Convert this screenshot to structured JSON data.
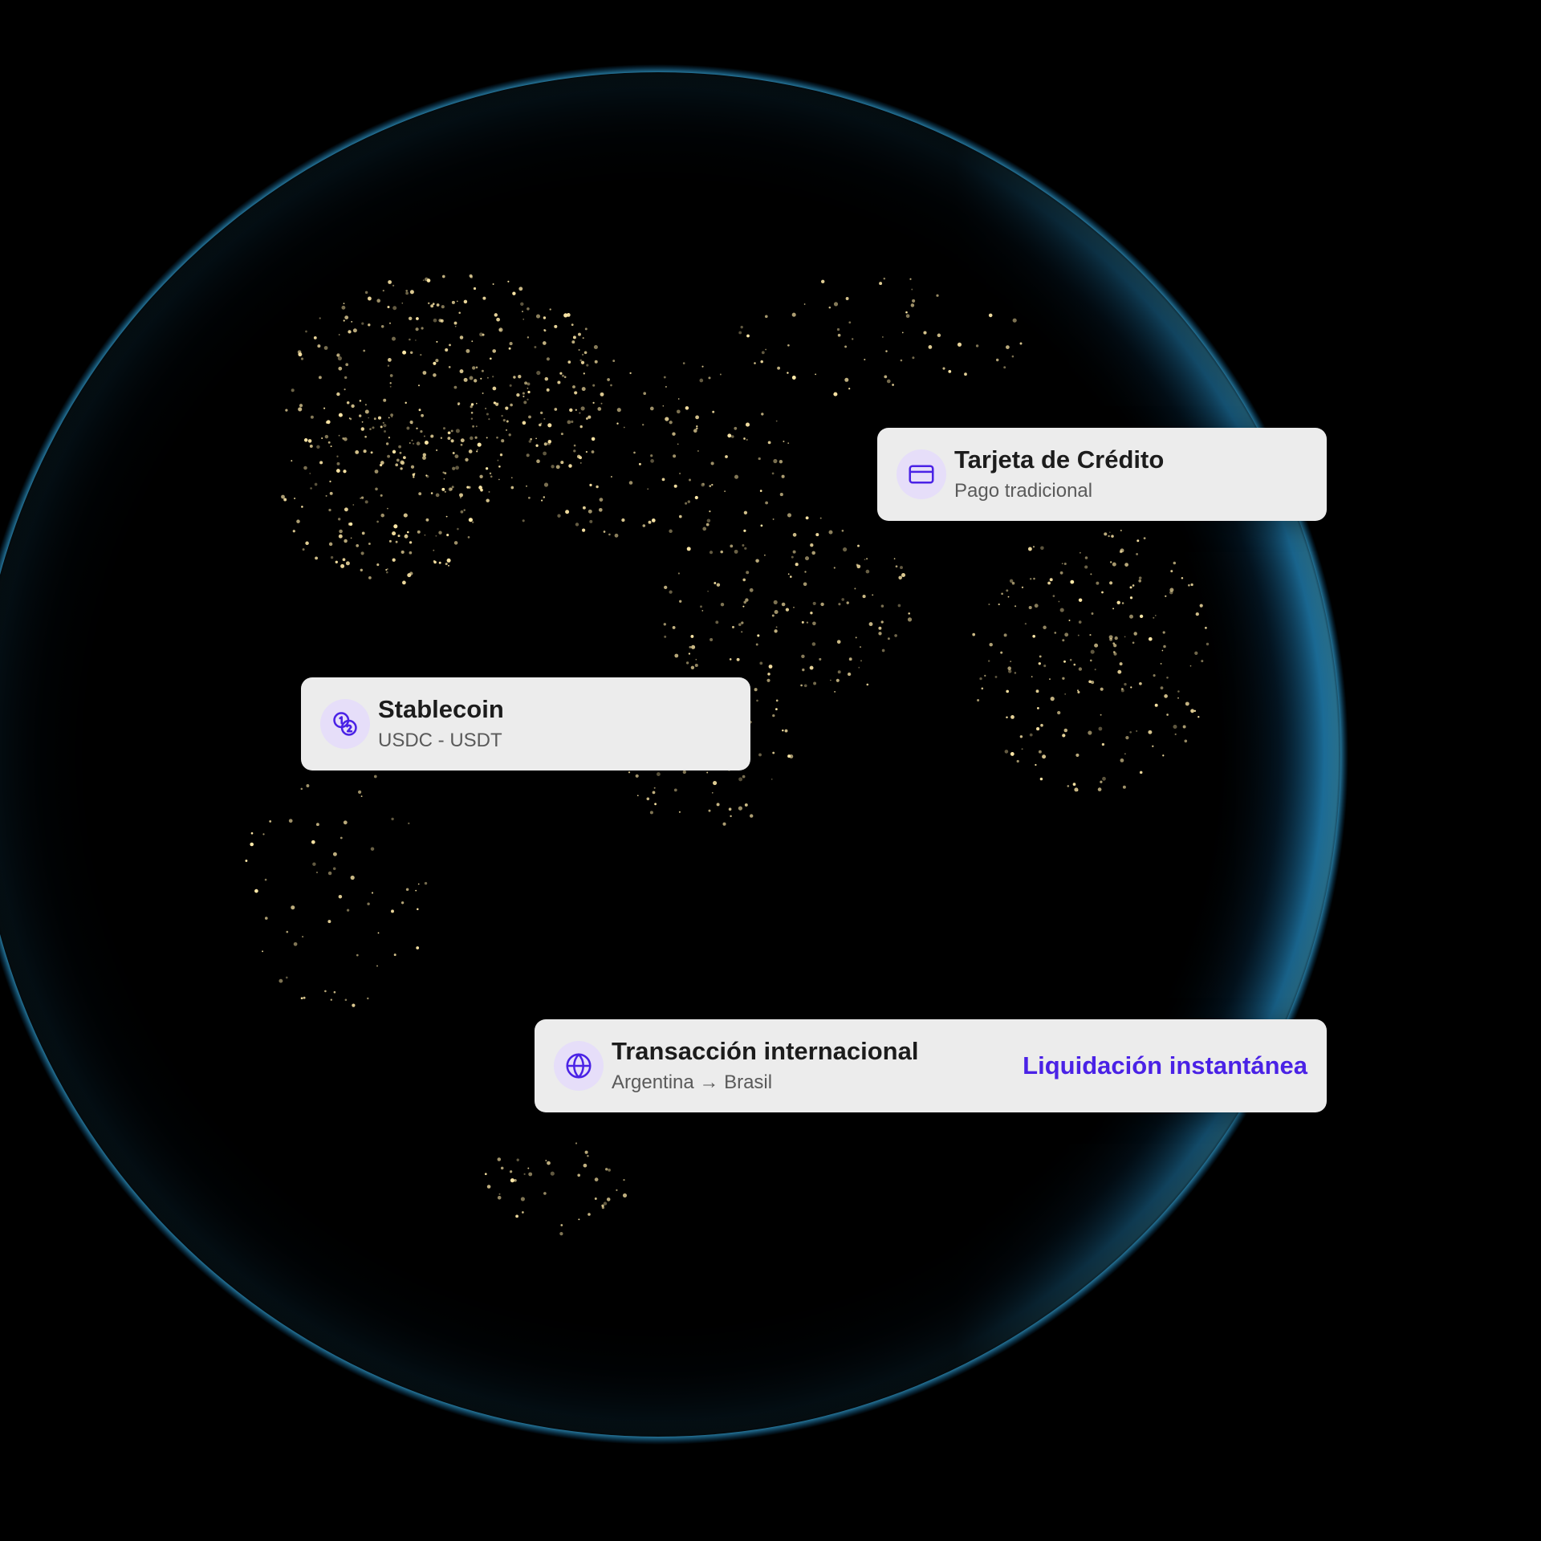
{
  "background": {
    "image_description": "night-side-earth-globe",
    "colors": {
      "space": "#000000",
      "atmosphere": "#35b3f2",
      "city_lights": "#ffe9a8"
    }
  },
  "accent_color": "#4a22e6",
  "cards": {
    "credit_card": {
      "icon": "credit-card-icon",
      "title": "Tarjeta de Crédito",
      "subtitle": "Pago tradicional"
    },
    "stablecoin": {
      "icon": "coins-icon",
      "title": "Stablecoin",
      "subtitle": "USDC - USDT"
    },
    "international": {
      "icon": "globe-icon",
      "title": "Transacción internacional",
      "subtitle": "Argentina → Brasil",
      "badge": "Liquidación instantánea"
    }
  }
}
